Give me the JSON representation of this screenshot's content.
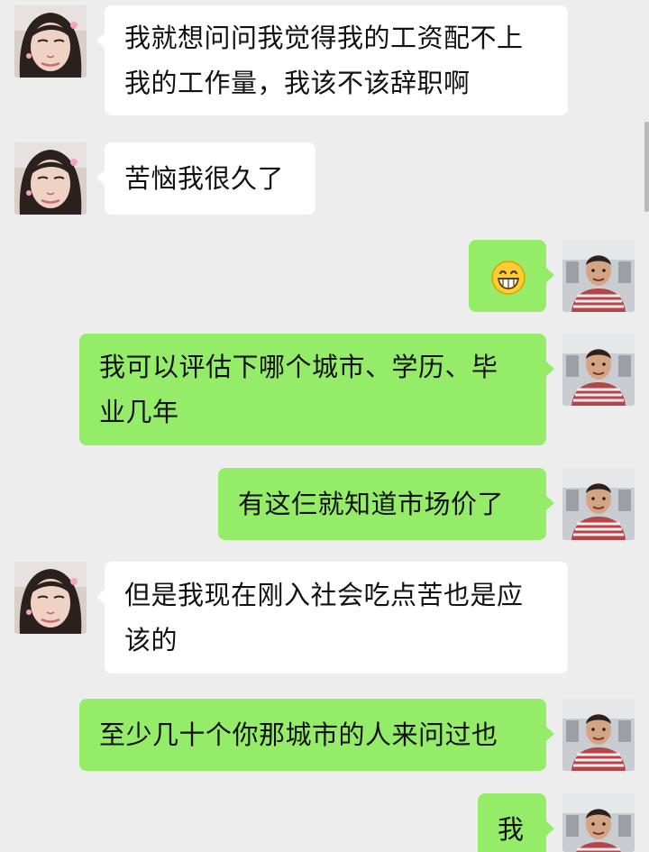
{
  "messages": [
    {
      "side": "in",
      "lines": [
        "我就想问问我觉得我的工资配不上",
        "我的工作量，我该不该辞职啊"
      ]
    },
    {
      "side": "in",
      "lines": [
        "苦恼我很久了"
      ]
    },
    {
      "side": "out",
      "emoji": "grinning-face-icon"
    },
    {
      "side": "out",
      "lines": [
        "我可以评估下哪个城市、学历、毕",
        "业几年"
      ]
    },
    {
      "side": "out",
      "lines": [
        "有这仨就知道市场价了"
      ]
    },
    {
      "side": "in",
      "lines": [
        "但是我现在刚入社会吃点苦也是应",
        "该的"
      ]
    },
    {
      "side": "out",
      "lines": [
        "至少几十个你那城市的人来问过也"
      ]
    },
    {
      "side": "out",
      "lines": [
        "我"
      ]
    }
  ],
  "colors": {
    "background": "#ededed",
    "incoming_bubble": "#ffffff",
    "outgoing_bubble": "#95ec69"
  }
}
